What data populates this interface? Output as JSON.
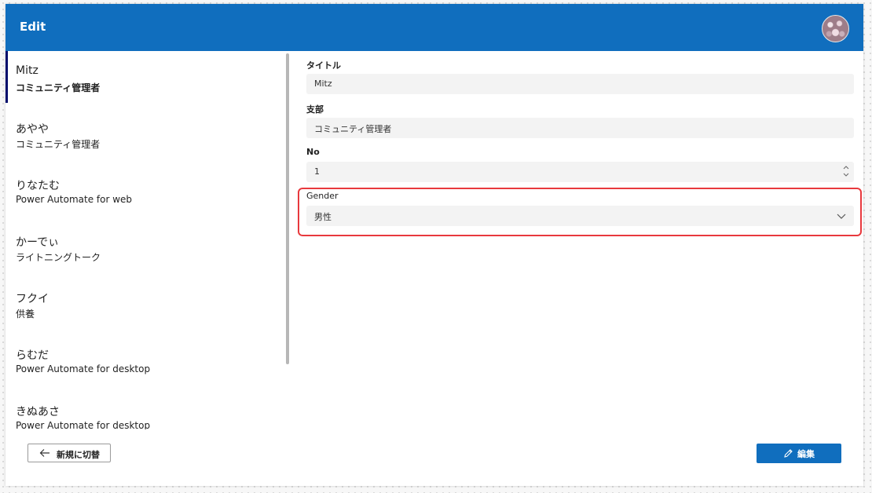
{
  "header": {
    "title": "Edit"
  },
  "gallery": {
    "items": [
      {
        "title": "Mitz",
        "subtitle": "コミュニティ管理者"
      },
      {
        "title": "あやや",
        "subtitle": "コミュニティ管理者"
      },
      {
        "title": "りなたむ",
        "subtitle": "Power Automate for web"
      },
      {
        "title": "かーでぃ",
        "subtitle": "ライトニングトーク"
      },
      {
        "title": "フクイ",
        "subtitle": "供養"
      },
      {
        "title": "らむだ",
        "subtitle": "Power Automate for desktop"
      },
      {
        "title": "きぬあさ",
        "subtitle": "Power Automate for desktop"
      }
    ],
    "selected_index": 0
  },
  "form": {
    "title": {
      "label": "タイトル",
      "value": "Mitz"
    },
    "branch": {
      "label": "支部",
      "value": "コミュニティ管理者"
    },
    "no": {
      "label": "No",
      "value": "1"
    },
    "gender": {
      "label": "Gender",
      "value": "男性"
    }
  },
  "buttons": {
    "switch_new": "新規に切替",
    "edit": "編集"
  },
  "colors": {
    "header": "#106ebe",
    "selection_bar": "#000a6b",
    "highlight": "#e8393d"
  }
}
